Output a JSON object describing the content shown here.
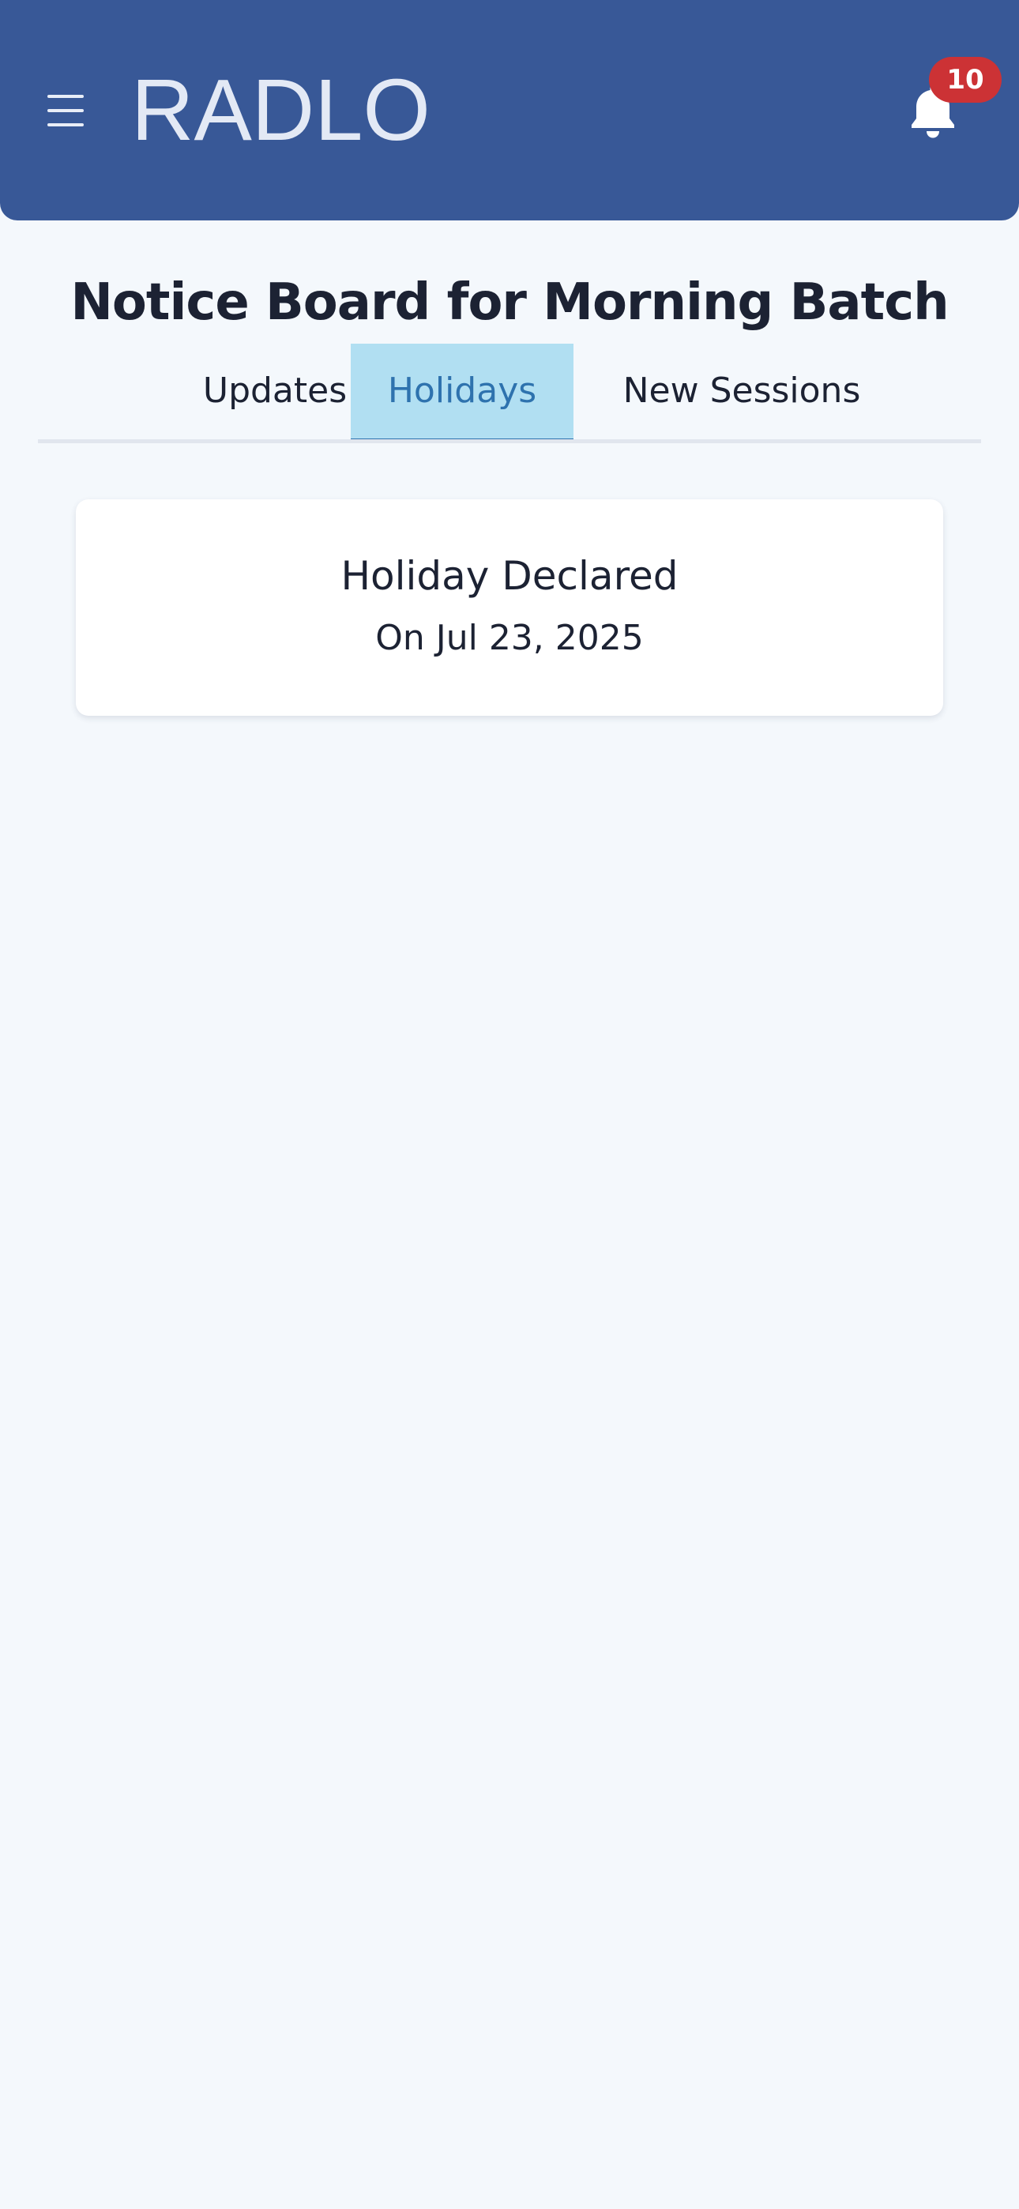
{
  "header": {
    "app_title": "RADLO",
    "notification_count": "10",
    "menu_icon": "hamburger-menu-icon",
    "bell_icon": "bell-icon",
    "badge_color": "#cc3235",
    "background_color": "#385897"
  },
  "page": {
    "title": "Notice Board for Morning Batch"
  },
  "tabs": [
    {
      "label": "Updates",
      "active": false
    },
    {
      "label": "Holidays",
      "active": true
    },
    {
      "label": "New Sessions",
      "active": false
    }
  ],
  "notices": [
    {
      "title": "Holiday Declared",
      "date": "On Jul 23, 2025"
    }
  ],
  "colors": {
    "active_tab_background": "#b1dff2",
    "active_tab_text": "#2e72ae",
    "page_background": "#f4f8fc"
  }
}
